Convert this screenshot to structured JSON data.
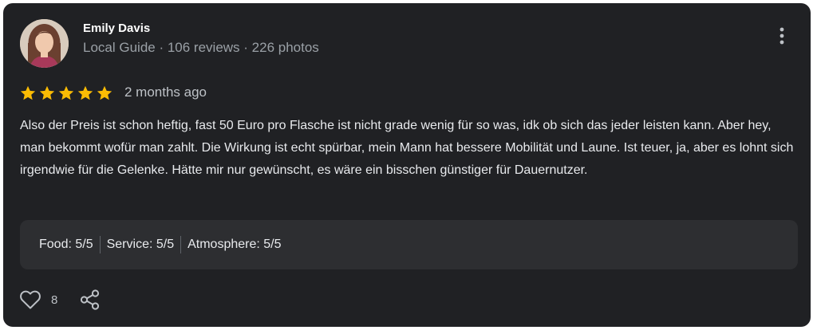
{
  "author": {
    "name": "Emily Davis",
    "meta": "Local Guide · 106 reviews · 226 photos"
  },
  "review": {
    "rating": 5,
    "max_rating": 5,
    "time": "2 months ago",
    "text": "Also der Preis ist schon heftig, fast 50 Euro pro Flasche ist nicht grade wenig für so was, idk ob sich das jeder leisten kann. Aber hey, man bekommt wofür man zahlt. Die Wirkung ist echt spürbar, mein Mann hat bessere Mobilität und Laune. Ist teuer, ja, aber es lohnt sich irgendwie für die Gelenke. Hätte mir nur gewünscht, es wäre ein bisschen günstiger für Dauernutzer."
  },
  "sub_ratings": {
    "food": "Food: 5/5",
    "service": "Service: 5/5",
    "atmosphere": "Atmosphere: 5/5"
  },
  "actions": {
    "like_count": "8"
  },
  "icons": {
    "like": "heart-icon",
    "share": "share-icon",
    "more": "more-vert-icon",
    "star": "star-icon"
  },
  "colors": {
    "card_background": "#202124",
    "star": "#fbbc04",
    "ratings_box": "#2d2e31",
    "secondary_text": "#9aa0a6"
  }
}
